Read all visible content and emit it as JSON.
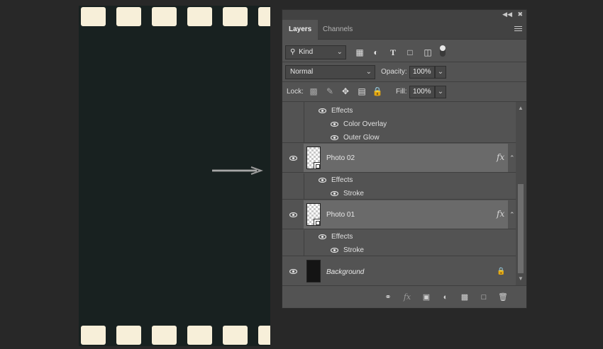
{
  "panel": {
    "tabs": [
      {
        "label": "Layers",
        "active": true
      },
      {
        "label": "Channels",
        "active": false
      }
    ],
    "filter": {
      "kind_label": "Kind"
    },
    "blend_mode": "Normal",
    "opacity_label": "Opacity:",
    "opacity_value": "100%",
    "lock_label": "Lock:",
    "fill_label": "Fill:",
    "fill_value": "100%",
    "top_effects": {
      "effects_label": "Effects",
      "items": [
        "Color Overlay",
        "Outer Glow"
      ]
    },
    "layers": [
      {
        "name": "Photo 02",
        "effects_label": "Effects",
        "effects": [
          "Stroke"
        ]
      },
      {
        "name": "Photo 01",
        "effects_label": "Effects",
        "effects": [
          "Stroke"
        ]
      },
      {
        "name": "Background",
        "locked": true
      }
    ]
  },
  "colors": {
    "background": "#282828",
    "film": "#182120",
    "film_hole": "#f7efd9",
    "panel": "#535353",
    "selected_row": "#6a6a6a"
  }
}
